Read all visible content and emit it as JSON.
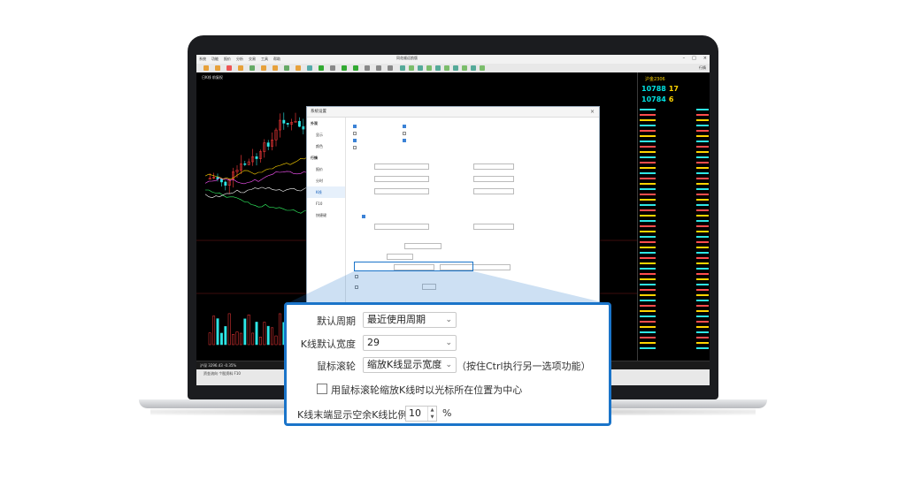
{
  "app": {
    "title": "同花顺远航版",
    "menu": [
      "系统",
      "功能",
      "报价",
      "分析",
      "交易",
      "工具",
      "帮助"
    ],
    "toolbar_right": "行情",
    "chart_title": "日K线 前复权",
    "statusbar": "沪深 3296.43 -0.35%",
    "bottombar": "资金流向  个股资料  F10"
  },
  "quote": {
    "name": "沪金2306",
    "price_1": "10788",
    "price_1_sub": "17",
    "price_2": "10784",
    "price_2_sub": "6"
  },
  "dialog": {
    "title": "系统设置",
    "close": "×",
    "nav": [
      {
        "label": "外观",
        "cat": true
      },
      {
        "label": "显示",
        "cat": false
      },
      {
        "label": "颜色",
        "cat": false
      },
      {
        "label": "行情",
        "cat": true
      },
      {
        "label": "报价",
        "cat": false
      },
      {
        "label": "分时",
        "cat": false
      },
      {
        "label": "K线",
        "cat": false,
        "selected": true
      },
      {
        "label": "F10",
        "cat": false
      },
      {
        "label": "快捷键",
        "cat": false
      }
    ]
  },
  "zoom": {
    "period_label": "默认周期",
    "period_value": "最近使用周期",
    "width_label": "K线默认宽度",
    "width_value": "29",
    "wheel_label": "鼠标滚轮",
    "wheel_value": "缩放K线显示宽度",
    "wheel_hint": "（按住Ctrl执行另一选项功能）",
    "center_checkbox_label": "用鼠标滚轮缩放K线时以光标所在位置为中心",
    "tail_label": "K线末端显示空余K线比例",
    "tail_value": "10",
    "tail_unit": "%"
  }
}
